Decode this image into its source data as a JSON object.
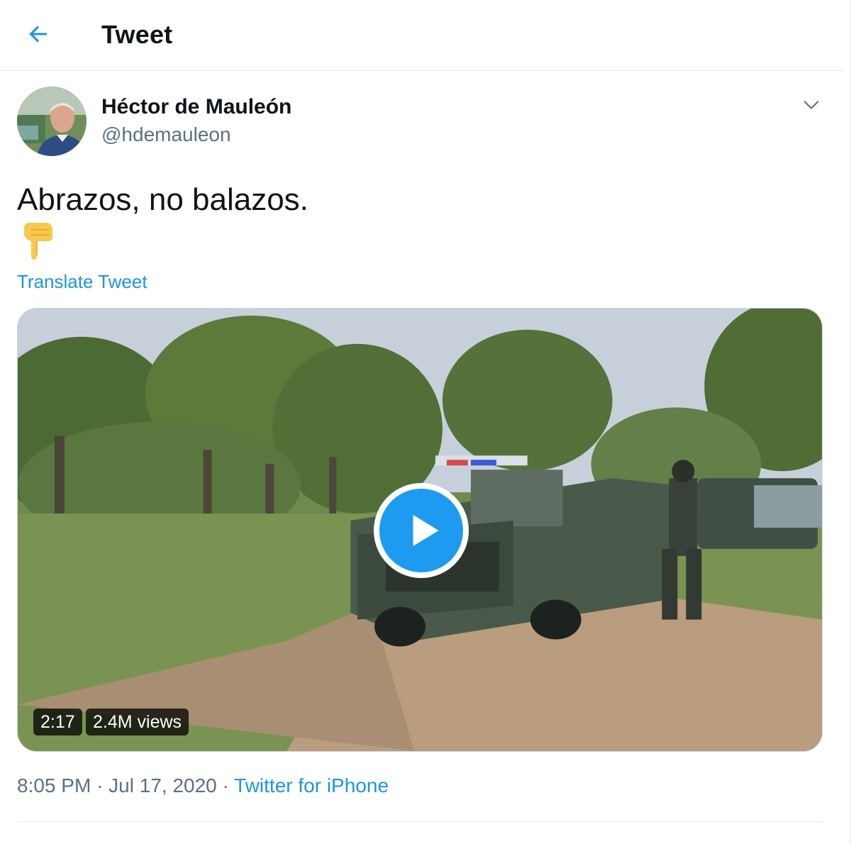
{
  "header": {
    "back_icon": "arrow-left-icon",
    "title": "Tweet"
  },
  "author": {
    "name": "Héctor de Mauleón",
    "handle": "@hdemauleon",
    "menu_icon": "chevron-down-icon"
  },
  "tweet": {
    "text": "Abrazos, no balazos.",
    "emoji": "👇",
    "translate_label": "Translate Tweet"
  },
  "media": {
    "type": "video",
    "play_icon": "play-icon",
    "duration": "2:17",
    "views": "2.4M views"
  },
  "meta": {
    "time": "8:05 PM",
    "separator": "·",
    "date": "Jul 17, 2020",
    "source": "Twitter for iPhone"
  },
  "colors": {
    "accent": "#1b95e0",
    "secondary_text": "#5b7083",
    "play_button": "#1d9bf0"
  }
}
